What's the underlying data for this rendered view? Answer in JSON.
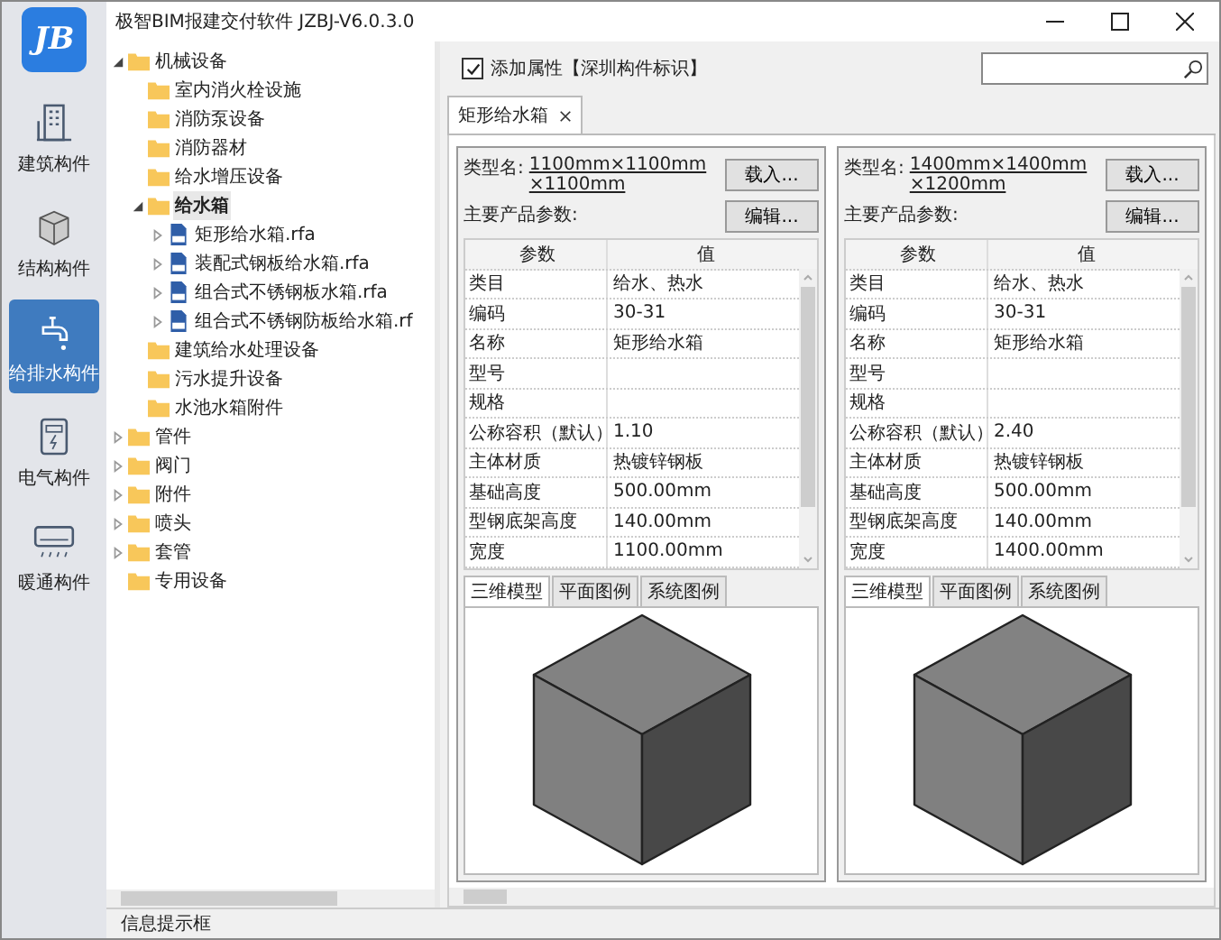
{
  "window": {
    "title": "极智BIM报建交付软件 JZBJ-V6.0.3.0"
  },
  "app_logo": {
    "text": "JB"
  },
  "rail": [
    {
      "label": "建筑构件",
      "kind": "building",
      "selected": false
    },
    {
      "label": "结构构件",
      "kind": "cube",
      "selected": false
    },
    {
      "label": "给排水构件",
      "kind": "faucet",
      "selected": true
    },
    {
      "label": "电气构件",
      "kind": "panel",
      "selected": false
    },
    {
      "label": "暖通构件",
      "kind": "hvac",
      "selected": false
    }
  ],
  "tree": [
    {
      "label": "机械设备",
      "kind": "folder",
      "expanded": true,
      "selected": false,
      "children": [
        {
          "label": "室内消火栓设施",
          "kind": "folder",
          "selected": false
        },
        {
          "label": "消防泵设备",
          "kind": "folder",
          "selected": false
        },
        {
          "label": "消防器材",
          "kind": "folder",
          "selected": false
        },
        {
          "label": "给水增压设备",
          "kind": "folder",
          "selected": false
        },
        {
          "label": "给水箱",
          "kind": "folder",
          "expanded": true,
          "selected": true,
          "children": [
            {
              "label": "矩形给水箱.rfa",
              "kind": "file",
              "expanded": false,
              "selected": false
            },
            {
              "label": "装配式钢板给水箱.rfa",
              "kind": "file",
              "expanded": false,
              "selected": false
            },
            {
              "label": "组合式不锈钢板水箱.rfa",
              "kind": "file",
              "expanded": false,
              "selected": false
            },
            {
              "label": "组合式不锈钢防板给水箱.rf",
              "kind": "file",
              "expanded": false,
              "selected": false
            }
          ]
        },
        {
          "label": "建筑给水处理设备",
          "kind": "folder",
          "selected": false
        },
        {
          "label": "污水提升设备",
          "kind": "folder",
          "selected": false
        },
        {
          "label": "水池水箱附件",
          "kind": "folder",
          "selected": false
        }
      ]
    },
    {
      "label": "管件",
      "kind": "folder",
      "expanded": false,
      "selected": false
    },
    {
      "label": "阀门",
      "kind": "folder",
      "expanded": false,
      "selected": false
    },
    {
      "label": "附件",
      "kind": "folder",
      "expanded": false,
      "selected": false
    },
    {
      "label": "喷头",
      "kind": "folder",
      "expanded": false,
      "selected": false
    },
    {
      "label": "套管",
      "kind": "folder",
      "expanded": false,
      "selected": false
    },
    {
      "label": "专用设备",
      "kind": "folder",
      "selected": false
    }
  ],
  "add_attribute": {
    "label": "添加属性【深圳构件标识】",
    "checked": true
  },
  "doc_tabs": [
    {
      "label": "矩形给水箱",
      "selected": true
    }
  ],
  "cards": [
    {
      "type_label": "类型名:",
      "type_name": "1100mm×1100mm×1100mm",
      "load_button": "载入...",
      "edit_button": "编辑...",
      "params_label": "主要产品参数:",
      "columns": [
        "参数",
        "值"
      ],
      "rows": [
        {
          "param": "类目",
          "value": "给水、热水"
        },
        {
          "param": "编码",
          "value": "30-31"
        },
        {
          "param": "名称",
          "value": "矩形给水箱"
        },
        {
          "param": "型号"
        },
        {
          "param": "规格"
        },
        {
          "param": "公称容积（默认）",
          "value": "1.10"
        },
        {
          "param": "主体材质",
          "value": "热镀锌钢板"
        },
        {
          "param": "基础高度",
          "value": "500.00mm"
        },
        {
          "param": "型钢底架高度",
          "value": "140.00mm"
        },
        {
          "param": "宽度",
          "value": "1100.00mm"
        }
      ],
      "view_tabs": [
        {
          "label": "三维模型",
          "selected": true
        },
        {
          "label": "平面图例",
          "selected": false
        },
        {
          "label": "系统图例",
          "selected": false
        }
      ]
    },
    {
      "type_label": "类型名:",
      "type_name": "1400mm×1400mm×1200mm",
      "load_button": "载入...",
      "edit_button": "编辑...",
      "params_label": "主要产品参数:",
      "columns": [
        "参数",
        "值"
      ],
      "rows": [
        {
          "param": "类目",
          "value": "给水、热水"
        },
        {
          "param": "编码",
          "value": "30-31"
        },
        {
          "param": "名称",
          "value": "矩形给水箱"
        },
        {
          "param": "型号"
        },
        {
          "param": "规格"
        },
        {
          "param": "公称容积（默认）",
          "value": "2.40"
        },
        {
          "param": "主体材质",
          "value": "热镀锌钢板"
        },
        {
          "param": "基础高度",
          "value": "500.00mm"
        },
        {
          "param": "型钢底架高度",
          "value": "140.00mm"
        },
        {
          "param": "宽度",
          "value": "1400.00mm"
        }
      ],
      "view_tabs": [
        {
          "label": "三维模型",
          "selected": true
        },
        {
          "label": "平面图例",
          "selected": false
        },
        {
          "label": "系统图例",
          "selected": false
        }
      ]
    }
  ],
  "status_bar": {
    "text": "信息提示框"
  }
}
